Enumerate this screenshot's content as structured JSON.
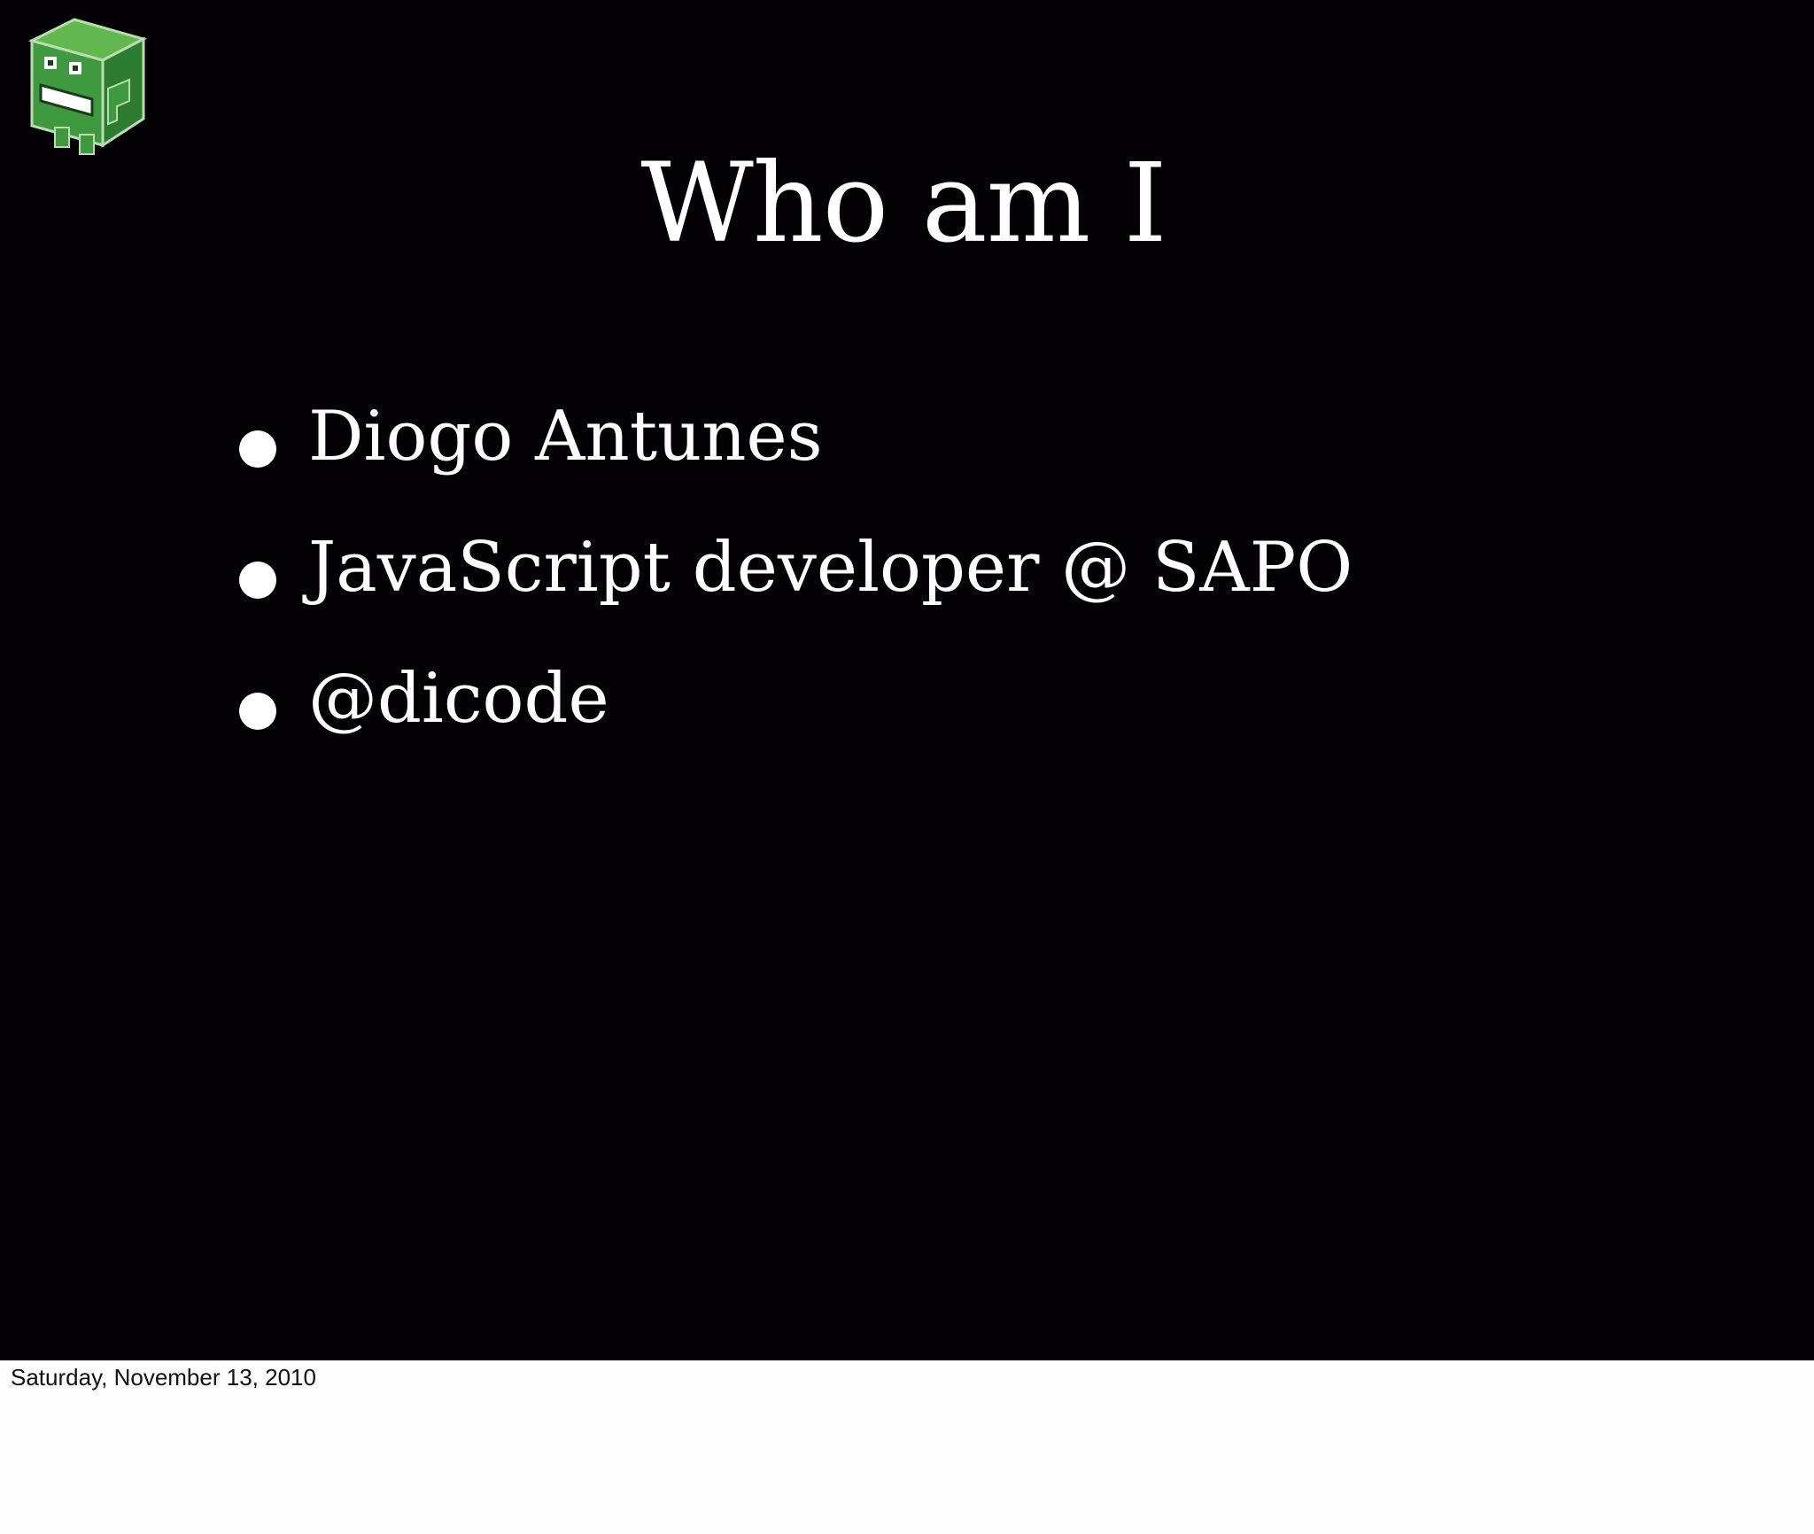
{
  "slide": {
    "title": "Who am I",
    "bullets": [
      "Diogo Antunes",
      "JavaScript developer @ SAPO",
      "@dicode"
    ],
    "logo_icon": "green-cube-robot-icon",
    "background_color": "#030104",
    "text_color": "#ffffff",
    "logo_color": "#3f9a3f"
  },
  "footer": {
    "date": "Saturday, November 13, 2010"
  }
}
